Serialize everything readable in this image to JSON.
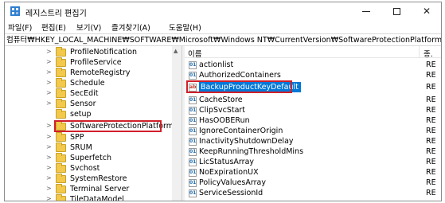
{
  "window": {
    "title": "레지스트리 편집기",
    "min_glyph": "",
    "close_glyph": "✕"
  },
  "menu": [
    "파일(F)",
    "편집(E)",
    "보기(V)",
    "즐겨찾기(A)",
    "도움말(H)"
  ],
  "address": "컴퓨터₩HKEY_LOCAL_MACHINE₩SOFTWARE₩Microsoft₩Windows NT₩CurrentVersion₩SoftwareProtectionPlatform",
  "tree": {
    "items": [
      "ProfileNotification",
      "ProfileService",
      "RemoteRegistry",
      "Schedule",
      "SecEdit",
      "Sensor",
      "setup",
      "SoftwareProtectionPlatform",
      "SPP",
      "SRUM",
      "Superfetch",
      "Svchost",
      "SystemRestore",
      "Terminal Server",
      "TileDataModel"
    ],
    "highlighted": "SoftwareProtectionPlatform"
  },
  "list": {
    "header_name": "이름",
    "header_type": "종.",
    "rows": [
      {
        "name": "actionlist",
        "type": "RE",
        "icon": "binary-value-icon"
      },
      {
        "name": "AuthorizedContainers",
        "type": "RE",
        "icon": "binary-value-icon"
      },
      {
        "name": "BackupProductKeyDefault",
        "type": "RE",
        "icon": "string-value-icon",
        "selected": true
      },
      {
        "name": "CacheStore",
        "type": "RE",
        "icon": "binary-value-icon"
      },
      {
        "name": "ClipSvcStart",
        "type": "RE",
        "icon": "binary-value-icon"
      },
      {
        "name": "HasOOBERun",
        "type": "RE",
        "icon": "binary-value-icon"
      },
      {
        "name": "IgnoreContainerOrigin",
        "type": "RE",
        "icon": "binary-value-icon"
      },
      {
        "name": "InactivityShutdownDelay",
        "type": "RE",
        "icon": "binary-value-icon"
      },
      {
        "name": "KeepRunningThresholdMins",
        "type": "RE",
        "icon": "binary-value-icon"
      },
      {
        "name": "LicStatusArray",
        "type": "RE",
        "icon": "binary-value-icon"
      },
      {
        "name": "NoExpirationUX",
        "type": "RE",
        "icon": "binary-value-icon"
      },
      {
        "name": "PolicyValuesArray",
        "type": "RE",
        "icon": "binary-value-icon"
      },
      {
        "name": "ServiceSessionId",
        "type": "RE",
        "icon": "binary-value-icon"
      }
    ]
  },
  "colors": {
    "highlight_border": "#d0202a",
    "selection": "#0078d7"
  }
}
